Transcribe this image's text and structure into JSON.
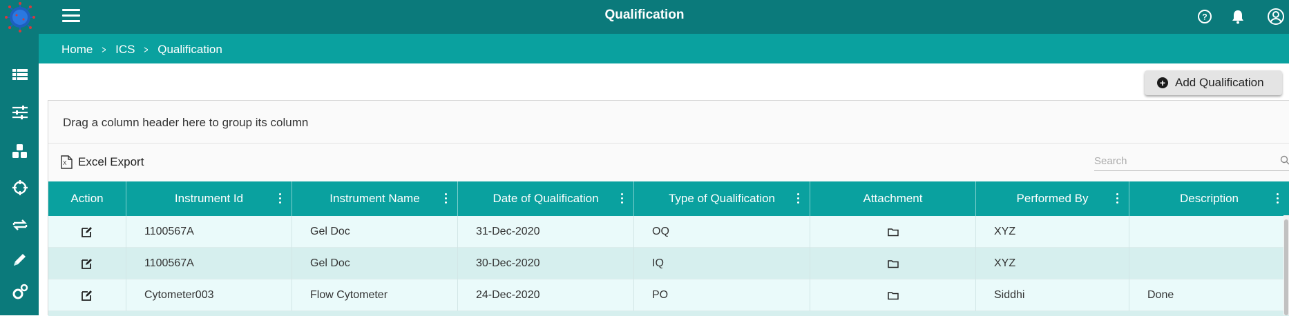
{
  "header": {
    "title": "Qualification",
    "icons": [
      "help-icon",
      "bell-icon",
      "user-icon"
    ]
  },
  "sidebar": {
    "icons": [
      "table-icon",
      "sliders-icon",
      "cubes-icon",
      "crosshair-icon",
      "exchange-icon",
      "pencil-icon",
      "settings-icon"
    ]
  },
  "breadcrumb": {
    "items": [
      {
        "label": "Home"
      },
      {
        "label": "ICS"
      },
      {
        "label": "Qualification"
      }
    ]
  },
  "actions": {
    "add_label": "Add Qualification"
  },
  "grid": {
    "group_text": "Drag a column header here to group its column",
    "excel_label": "Excel Export",
    "search_placeholder": "Search",
    "columns": [
      {
        "label": "Action"
      },
      {
        "label": "Instrument Id"
      },
      {
        "label": "Instrument Name"
      },
      {
        "label": "Date of Qualification"
      },
      {
        "label": "Type of Qualification"
      },
      {
        "label": "Attachment"
      },
      {
        "label": "Performed By"
      },
      {
        "label": "Description"
      }
    ],
    "rows": [
      {
        "instrument_id": "1100567A",
        "instrument_name": "Gel Doc",
        "date": "31-Dec-2020",
        "type": "OQ",
        "performed_by": "XYZ",
        "description": ""
      },
      {
        "instrument_id": "1100567A",
        "instrument_name": "Gel Doc",
        "date": "30-Dec-2020",
        "type": "IQ",
        "performed_by": "XYZ",
        "description": ""
      },
      {
        "instrument_id": "Cytometer003",
        "instrument_name": "Flow Cytometer",
        "date": "24-Dec-2020",
        "type": "PO",
        "performed_by": "Siddhi",
        "description": "Done"
      }
    ]
  },
  "colors": {
    "topbar": "#0b7a7b",
    "accent": "#0aa19f",
    "row_light": "#eafafa",
    "row_dark": "#d6efee"
  }
}
